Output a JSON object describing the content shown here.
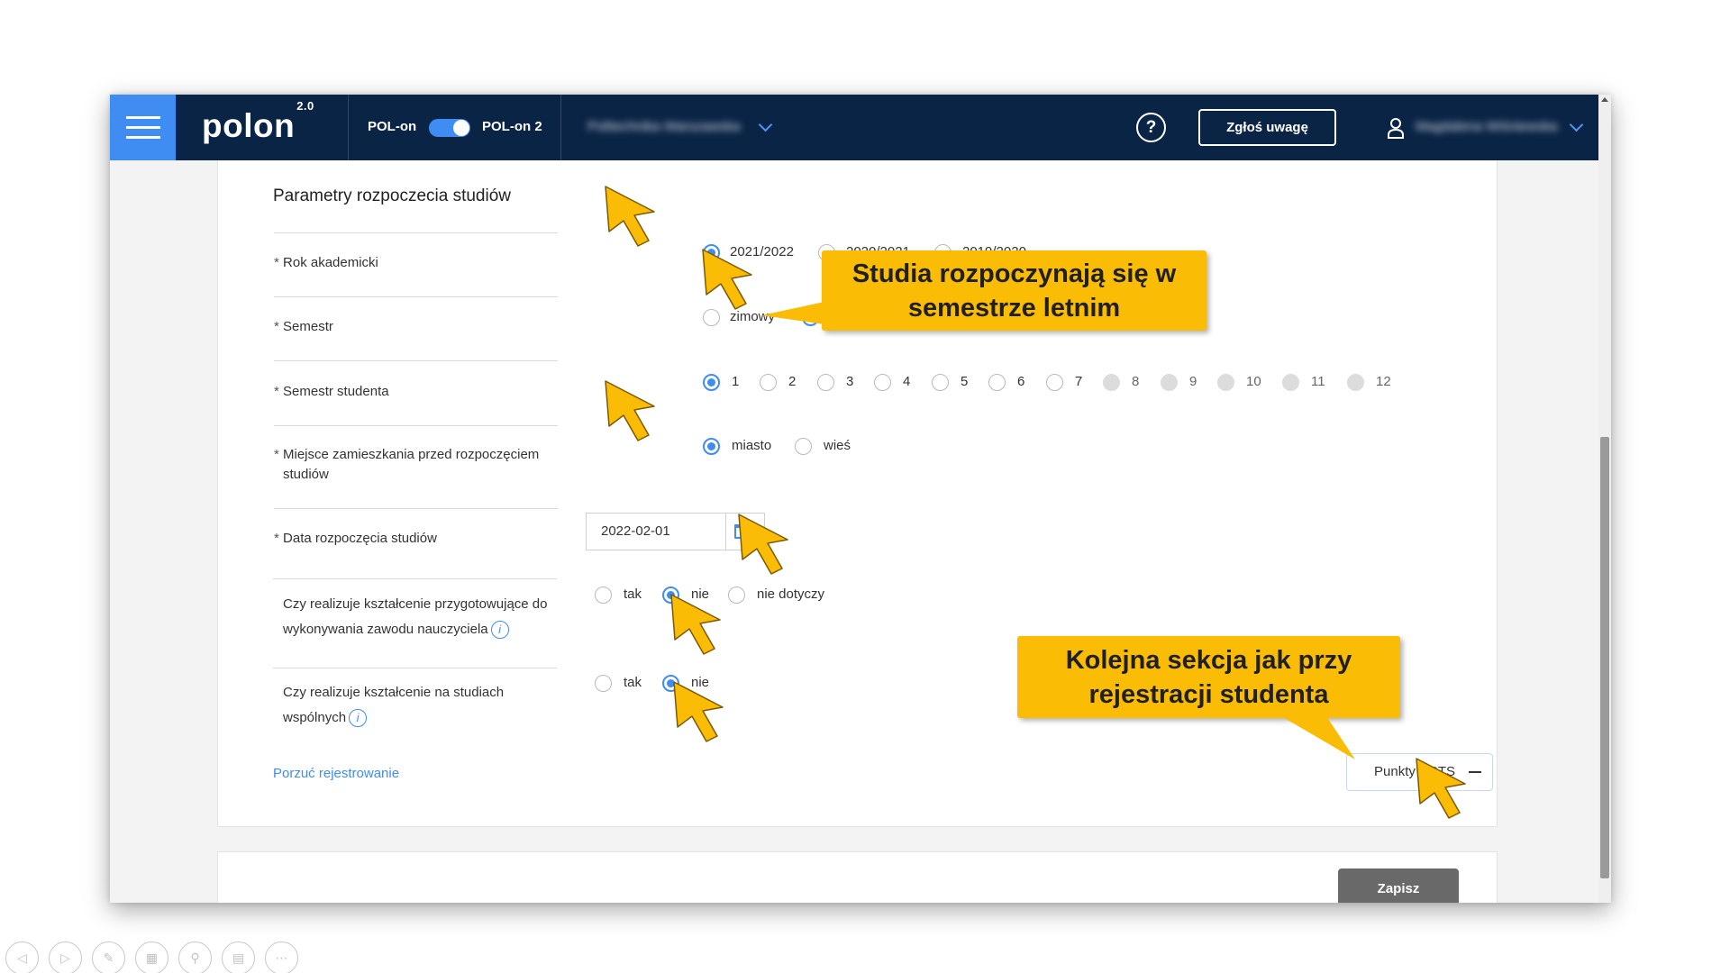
{
  "navbar": {
    "logo": "polon",
    "logo_version": "2.0",
    "toggle_left": "POL-on",
    "toggle_right": "POL-on 2",
    "institution": "Politechnika Warszawska",
    "help": "?",
    "report_button": "Zgłoś uwagę",
    "user": "Magdalena Wiśniewska"
  },
  "form": {
    "section_title": "Parametry rozpoczecia studiów",
    "required_mark": "*",
    "rows": [
      {
        "label": "Rok akademicki",
        "options": [
          "2021/2022",
          "2020/2021",
          "2019/2020"
        ],
        "selected": "2021/2022"
      },
      {
        "label": "Semestr",
        "options": [
          "zimowy",
          "letni"
        ],
        "selected": "letni"
      },
      {
        "label": "Semestr studenta",
        "options": [
          "1",
          "2",
          "3",
          "4",
          "5",
          "6",
          "7",
          "8",
          "9",
          "10",
          "11",
          "12"
        ],
        "selected": "1",
        "disabled_from": "8"
      },
      {
        "label_line1": "Miejsce zamieszkania przed rozpoczęciem",
        "label_line2": "studiów",
        "options": [
          "miasto",
          "wieś"
        ],
        "selected": "miasto"
      },
      {
        "label": "Data rozpoczęcia studiów",
        "value": "2022-02-01"
      },
      {
        "label_line1": "Czy realizuje kształcenie przygotowujące do",
        "label_line2": "wykonywania zawodu nauczyciela",
        "options": [
          "tak",
          "nie",
          "nie dotyczy"
        ],
        "selected": "nie"
      },
      {
        "label_line1": "Czy realizuje kształcenie na studiach",
        "label_line2": "wspólnych",
        "options": [
          "tak",
          "nie"
        ],
        "selected": "nie"
      }
    ],
    "info_icon": "i",
    "abandon_link": "Porzuć rejestrowanie",
    "ects_button": "Punkty ECTS",
    "save_button": "Zapisz"
  },
  "callouts": {
    "first_line1": "Studia rozpoczynają się w",
    "first_line2": "semestrze letnim",
    "second_line1": "Kolejna sekcja jak przy",
    "second_line2": "rejestracji studenta"
  },
  "colors": {
    "navbar": "#0a2446",
    "accent": "#3f8cf2",
    "callout": "#fbbc05",
    "save_button": "#696969"
  },
  "presenter_toolbar": [
    "prev-icon",
    "next-icon",
    "pen-icon",
    "slides-icon",
    "zoom-icon",
    "subtitles-icon",
    "more-icon"
  ]
}
